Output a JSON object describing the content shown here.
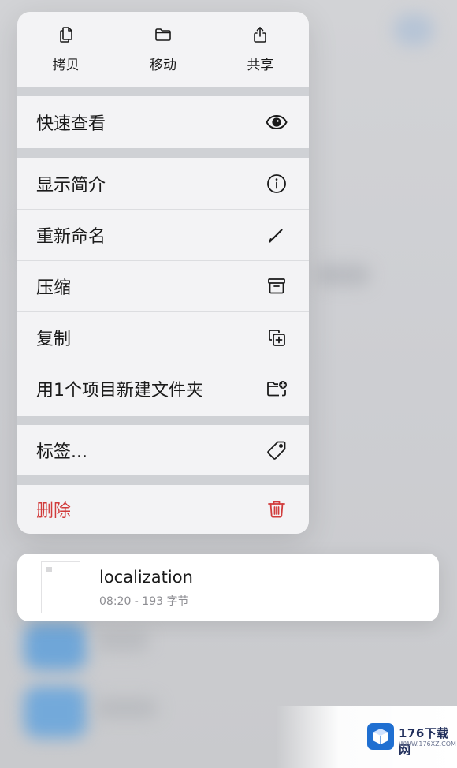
{
  "quick_actions": [
    {
      "label": "拷贝",
      "icon": "copy-icon"
    },
    {
      "label": "移动",
      "icon": "folder-icon"
    },
    {
      "label": "共享",
      "icon": "share-icon"
    }
  ],
  "menu": {
    "quick_look": {
      "label": "快速查看",
      "icon": "eye-icon"
    },
    "items": [
      {
        "label": "显示简介",
        "icon": "info-icon"
      },
      {
        "label": "重新命名",
        "icon": "pencil-icon"
      },
      {
        "label": "压缩",
        "icon": "archive-icon"
      },
      {
        "label": "复制",
        "icon": "duplicate-icon"
      },
      {
        "label": "用1个项目新建文件夹",
        "icon": "folder-plus-icon"
      }
    ],
    "tags": {
      "label": "标签...",
      "icon": "tag-icon"
    },
    "delete": {
      "label": "删除",
      "icon": "trash-icon"
    }
  },
  "file": {
    "name": "localization",
    "meta": "08:20 - 193 字节"
  },
  "watermark": {
    "text": "176下载网",
    "sub": "WWW.176XZ.COM"
  },
  "colors": {
    "destructive": "#d13b3b",
    "menu_bg": "#f3f3f5",
    "separator": "#cfd1d5"
  }
}
